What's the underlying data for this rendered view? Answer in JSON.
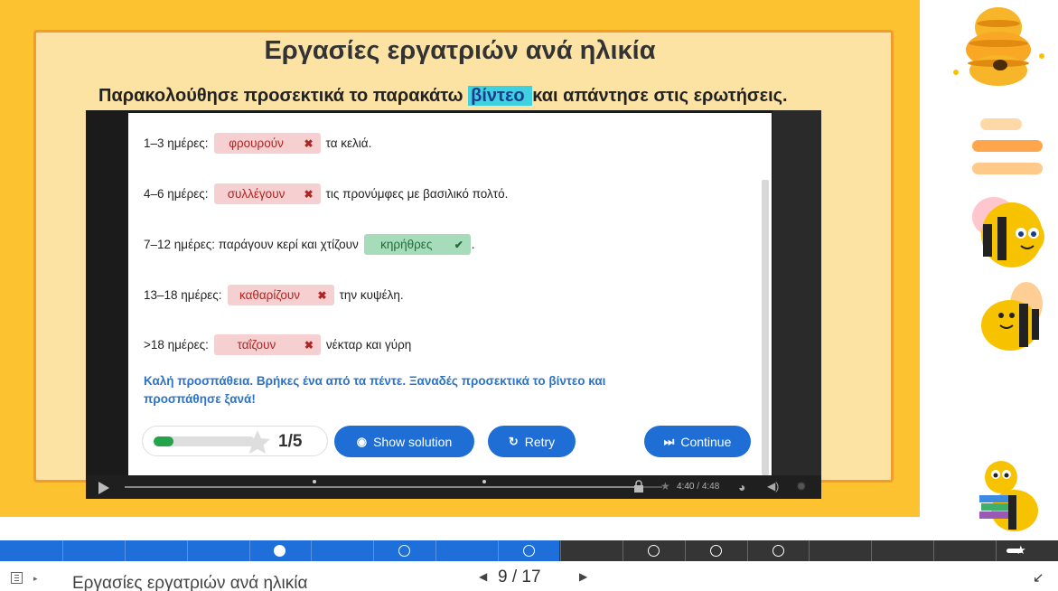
{
  "slide": {
    "title": "Εργασίες εργατριών ανά ηλικία",
    "instruction_before": "Παρακολούθησε προσεκτικά το παρακάτω ",
    "instruction_highlight": "βίντεο ",
    "instruction_after": "και απάντησε στις ερωτήσεις."
  },
  "quiz": {
    "rows": [
      {
        "prefix": "1–3 ημέρες:",
        "answer": "φρουρούν",
        "mark": "✖",
        "suffix": "τα κελιά.",
        "correct": false
      },
      {
        "prefix": "4–6 ημέρες:",
        "answer": "συλλέγουν",
        "mark": "✖",
        "suffix": "τις προνύμφες με βασιλικό πολτό.",
        "correct": false
      },
      {
        "prefix": "7–12 ημέρες: παράγουν κερί και χτίζουν",
        "answer": "κηρήθρες",
        "mark": "✔",
        "suffix": ".",
        "correct": true
      },
      {
        "prefix": "13–18 ημέρες:",
        "answer": "καθαρίζουν",
        "mark": "✖",
        "suffix": "την κυψέλη.",
        "correct": false
      },
      {
        "prefix": ">18 ημέρες:",
        "answer": "ταΐζουν",
        "mark": "✖",
        "suffix": "νέκταρ και γύρη",
        "correct": false
      }
    ],
    "feedback_line1": "Καλή προσπάθεια. Βρήκες ένα από τα πέντε. Ξαναδές προσεκτικά το βίντεο και",
    "feedback_line2": "προσπάθησε ξανά!",
    "score_text": "1/5",
    "score_fraction": 0.2,
    "buttons": {
      "show_solution": "Show solution",
      "retry": "Retry",
      "continue": "Continue"
    },
    "colors": {
      "wrong_bg": "#f6d0d0",
      "right_bg": "#a6dcb9",
      "button": "#1f6ed6",
      "feedback": "#2b73c8"
    }
  },
  "player": {
    "current_time": "4:40",
    "separator": " / ",
    "duration": "4:48",
    "progress_fraction": 0.97
  },
  "navigation": {
    "total_slides": 17,
    "current_slide": 9,
    "footer_title": "Εργασίες εργατριών ανά ηλικία",
    "page_current": "9",
    "page_separator": "/",
    "page_total": "17"
  },
  "icons": {
    "menu": "menu-icon",
    "prev": "◀",
    "next": "▶",
    "exit_fullscreen": "↙",
    "eye": "👁",
    "retry": "↻",
    "continue": "⏭",
    "star": "★"
  }
}
